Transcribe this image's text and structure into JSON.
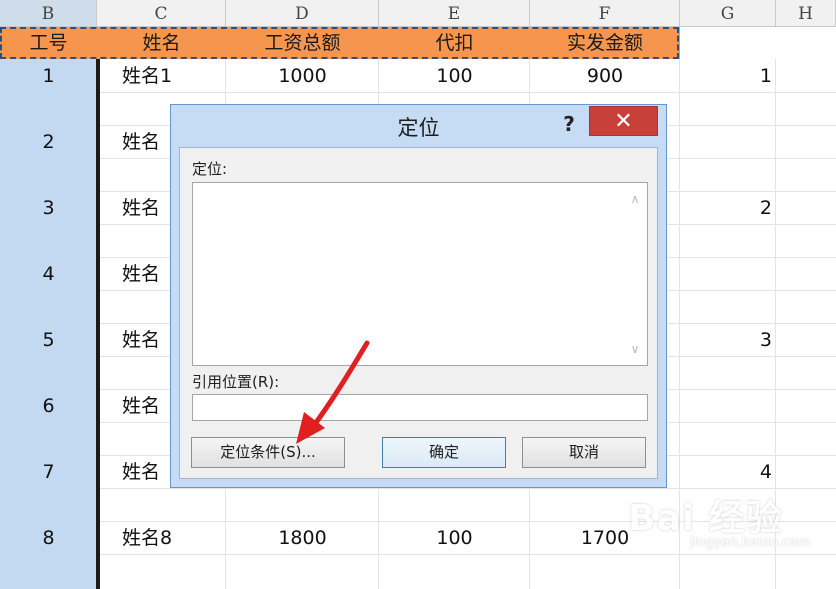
{
  "columns": [
    "B",
    "C",
    "D",
    "E",
    "F",
    "G",
    "H"
  ],
  "header_row": [
    "工号",
    "姓名",
    "工资总额",
    "代扣",
    "实发金额"
  ],
  "rows": [
    {
      "id": "1",
      "name": "姓名1",
      "total": "1000",
      "deduct": "100",
      "net": "900",
      "g": "1"
    },
    {
      "id": "2",
      "name": "姓名",
      "total": "",
      "deduct": "",
      "net": "",
      "g": ""
    },
    {
      "id": "3",
      "name": "姓名",
      "total": "",
      "deduct": "",
      "net": "",
      "g": "2"
    },
    {
      "id": "4",
      "name": "姓名",
      "total": "",
      "deduct": "",
      "net": "",
      "g": ""
    },
    {
      "id": "5",
      "name": "姓名",
      "total": "",
      "deduct": "",
      "net": "",
      "g": "3"
    },
    {
      "id": "6",
      "name": "姓名",
      "total": "",
      "deduct": "",
      "net": "",
      "g": ""
    },
    {
      "id": "7",
      "name": "姓名",
      "total": "",
      "deduct": "",
      "net": "",
      "g": "4"
    },
    {
      "id": "8",
      "name": "姓名8",
      "total": "1800",
      "deduct": "100",
      "net": "1700",
      "g": ""
    }
  ],
  "dialog": {
    "title": "定位",
    "help": "?",
    "close": "✕",
    "goto_label": "定位:",
    "reference_label": "引用位置(R):",
    "reference_value": "",
    "special_button": "定位条件(S)...",
    "ok_button": "确定",
    "cancel_button": "取消"
  },
  "watermark": {
    "main": "Bai 经验",
    "sub": "jingyan.baidu.com"
  },
  "colors": {
    "header_orange": "#f6964e",
    "selected_blue": "#c2d9f1",
    "close_red": "#c7403a",
    "arrow_red": "#e02020"
  }
}
